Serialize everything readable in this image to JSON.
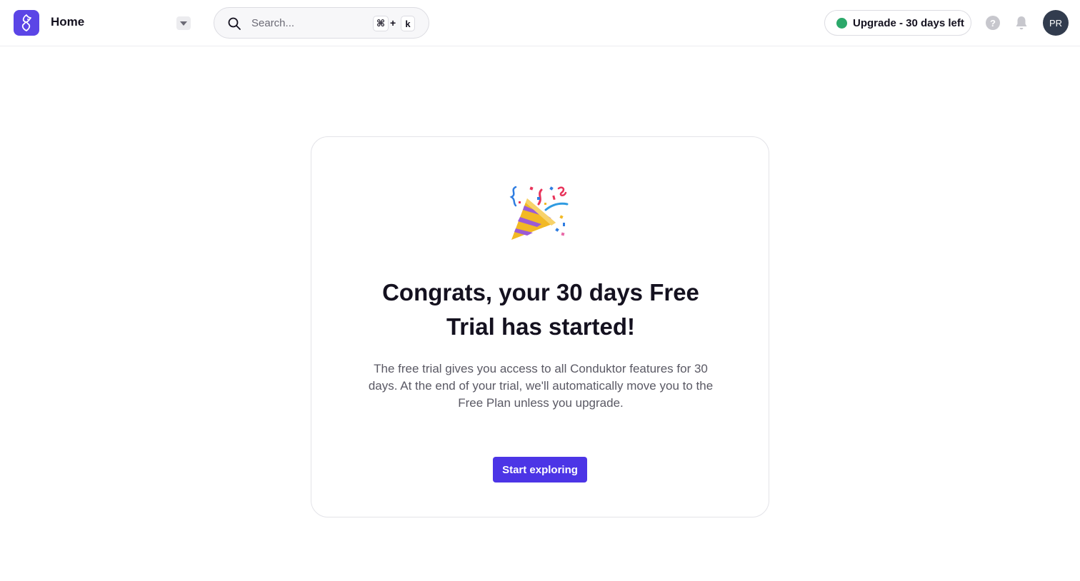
{
  "header": {
    "page_title": "Home",
    "search": {
      "placeholder": "Search...",
      "value": "",
      "shortcut_cmd": "⌘",
      "shortcut_plus": "+",
      "shortcut_key": "k"
    },
    "upgrade_label": "Upgrade - 30 days left",
    "upgrade_dot_color": "#2ba86a",
    "help_symbol": "?",
    "avatar_initials": "PR",
    "brand_color": "#5b45e6"
  },
  "card": {
    "icon": "party-popper-icon",
    "title": "Congrats, your 30 days Free Trial has started!",
    "description": "The free trial gives you access to all Conduktor features for 30 days. At the end of your trial, we'll automatically move you to the Free Plan unless you upgrade.",
    "button_label": "Start exploring",
    "button_color": "#4c35e6"
  }
}
